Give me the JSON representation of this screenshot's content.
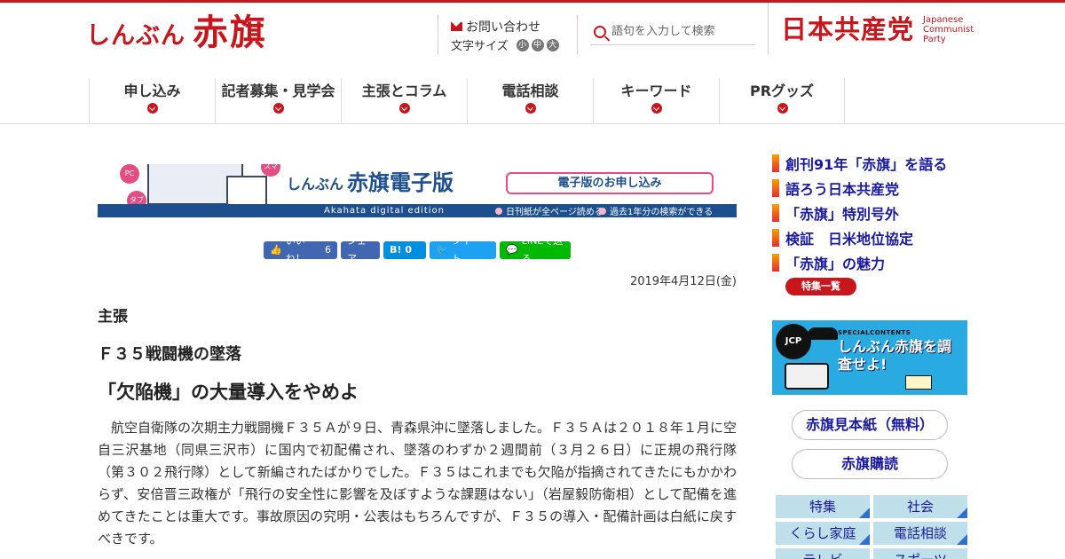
{
  "header": {
    "logo_small": "しんぶん",
    "logo_big": "赤旗",
    "contact": "お問い合わせ",
    "font_size_label": "文字サイズ",
    "font_sizes": [
      "小",
      "中",
      "大"
    ],
    "search_placeholder": "語句を入力して検索",
    "jcp_name": "日本共産党",
    "jcp_en": [
      "Japanese",
      "Communist",
      "Party"
    ]
  },
  "nav": [
    {
      "label": "申し込み"
    },
    {
      "label": "記者募集・見学会"
    },
    {
      "label": "主張とコラム"
    },
    {
      "label": "電話相談"
    },
    {
      "label": "キーワード"
    },
    {
      "label": "PRグッズ"
    }
  ],
  "banner": {
    "pc": "PC",
    "tablet": "タブレット",
    "smartphone": "スマホ",
    "title_small": "しんぶん",
    "title_big": "赤旗電子版",
    "apply": "電子版のお申し込み",
    "edition": "Akahata digital edition",
    "feature1": "日刊紙が全ページ読める",
    "feature2": "過去1年分の検索ができる"
  },
  "social": {
    "like": "いいね！",
    "like_count": "6",
    "share": "シェア",
    "hatena": "B!",
    "hatena_count": "0",
    "tweet": "ツイート",
    "line": "LINEで送る"
  },
  "article": {
    "date": "2019年4月12日(金)",
    "label": "主張",
    "subtitle": "Ｆ３５戦闘機の墜落",
    "headline": "「欠陥機」の大量導入をやめよ",
    "body": "航空自衛隊の次期主力戦闘機Ｆ３５Ａが９日、青森県沖に墜落しました。Ｆ３５Ａは２０１８年１月に空自三沢基地（同県三沢市）に国内で初配備され、墜落のわずか２週間前（３月２６日）に正規の飛行隊（第３０２飛行隊）として新編されたばかりでした。Ｆ３５はこれまでも欠陥が指摘されてきたにもかかわらず、安倍晋三政権が「飛行の安全性に影響を及ぼすような課題はない」（岩屋毅防衛相）として配備を進めてきたことは重大です。事故原因の究明・公表はもちろんですが、Ｆ３５の導入・配備計画は白紙に戻すべきです。"
  },
  "sidebar": {
    "specials": [
      {
        "label": "創刊91年「赤旗」を語る"
      },
      {
        "label": "語ろう日本共産党"
      },
      {
        "label": "「赤旗」特別号外"
      },
      {
        "label": "検証　日米地位協定"
      },
      {
        "label": "「赤旗」の魅力"
      }
    ],
    "more": "特集一覧",
    "magazine": {
      "badge": "JCP",
      "special": "SPECIALCONTENTS",
      "title": "しんぶん赤旗を調査せよ!"
    },
    "sample": "赤旗見本紙（無料）",
    "subscribe": "赤旗購読",
    "categories": [
      {
        "label": "特集"
      },
      {
        "label": "社会"
      },
      {
        "label": "くらし家庭"
      },
      {
        "label": "電話相談"
      },
      {
        "label": "テレビ"
      },
      {
        "label": "スポーツ"
      }
    ]
  },
  "colors": {
    "brand": "#c8161d",
    "navy": "#1d4f8f",
    "link": "#1a1aa0"
  }
}
